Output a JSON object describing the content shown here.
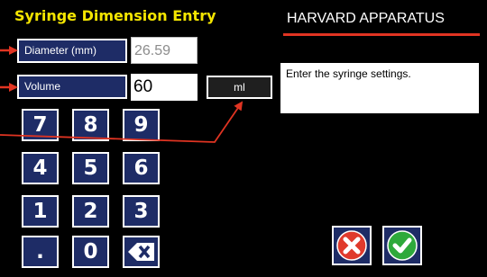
{
  "header": {
    "title": "Syringe Dimension Entry",
    "brand": "HARVARD APPARATUS"
  },
  "fields": {
    "diameter_label": "Diameter (mm)",
    "diameter_value": "26.59",
    "volume_label": "Volume",
    "volume_value": "60",
    "unit_label": "ml"
  },
  "message": "Enter the syringe settings.",
  "keypad": {
    "keys": [
      "7",
      "8",
      "9",
      "4",
      "5",
      "6",
      "1",
      "2",
      "3",
      ".",
      "0"
    ],
    "backspace_icon": "backspace-icon"
  },
  "actions": {
    "cancel_icon": "cancel-x-icon",
    "confirm_icon": "confirm-check-icon"
  },
  "colors": {
    "background": "#000000",
    "title": "#f5e600",
    "button_blue": "#1e2c66",
    "accent_red": "#e03422",
    "cancel_red": "#e03a2c",
    "confirm_green": "#2ea93b"
  }
}
